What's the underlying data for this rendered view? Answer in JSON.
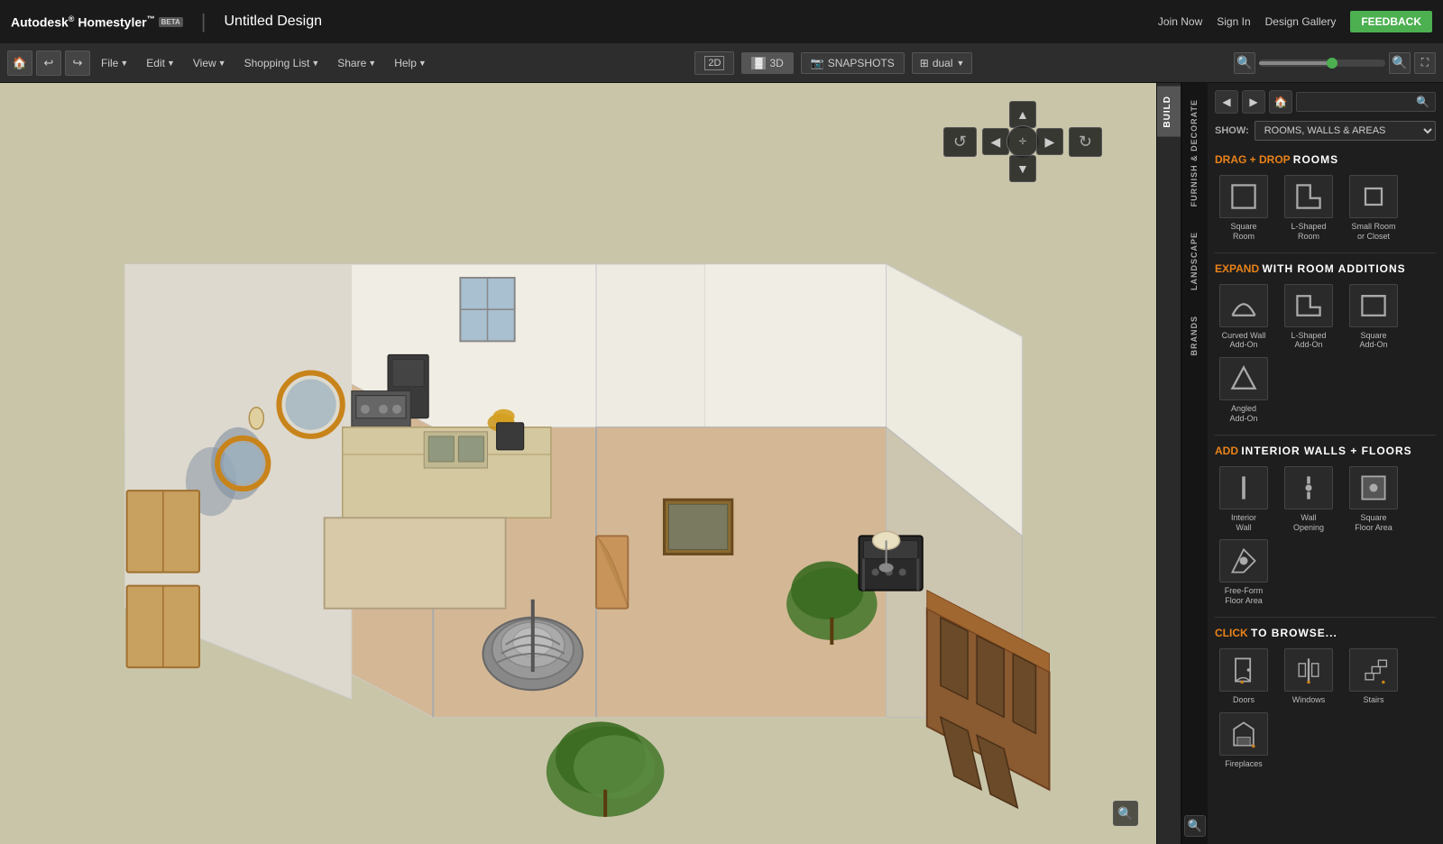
{
  "app": {
    "name": "Autodesk® Homestyler™",
    "beta_label": "BETA",
    "design_title": "Untitled Design",
    "top_bar": {
      "join_now": "Join Now",
      "sign_in": "Sign In",
      "design_gallery": "Design Gallery",
      "feedback": "FEEDBACK"
    }
  },
  "toolbar": {
    "menus": [
      "File",
      "Edit",
      "View",
      "Shopping List",
      "Share",
      "Help"
    ],
    "view_2d": "2D",
    "view_3d": "3D",
    "snapshots": "SNAPSHOTS",
    "dual": "dual"
  },
  "right_panel": {
    "show_label": "SHOW:",
    "show_value": "ROOMS, WALLS & AREAS",
    "vertical_tabs": [
      {
        "id": "build",
        "label": "BUILD",
        "active": true
      },
      {
        "id": "furnish",
        "label": "FURNISH & DECORATE",
        "active": false
      },
      {
        "id": "landscape",
        "label": "LANDSCAPE",
        "active": false
      },
      {
        "id": "brands",
        "label": "BRANDS",
        "active": false
      }
    ],
    "sections": {
      "drag_drop_rooms": {
        "prefix": "DRAG + DROP",
        "rest": "ROOMS",
        "items": [
          {
            "id": "square-room",
            "label": "Square\nRoom"
          },
          {
            "id": "l-shaped-room",
            "label": "L-Shaped\nRoom"
          },
          {
            "id": "small-room",
            "label": "Small Room\nor Closet"
          }
        ]
      },
      "expand_with": {
        "prefix": "EXPAND",
        "rest": "WITH ROOM ADDITIONS",
        "items": [
          {
            "id": "curved-wall",
            "label": "Curved Wall\nAdd-On"
          },
          {
            "id": "l-shaped-addon",
            "label": "L-Shaped\nAdd-On"
          },
          {
            "id": "square-addon",
            "label": "Square\nAdd-On"
          },
          {
            "id": "angled-addon",
            "label": "Angled\nAdd-On"
          }
        ]
      },
      "interior_walls": {
        "prefix": "ADD",
        "rest": "INTERIOR WALLS + FLOORS",
        "items": [
          {
            "id": "interior-wall",
            "label": "Interior\nWall"
          },
          {
            "id": "wall-opening",
            "label": "Wall\nOpening"
          },
          {
            "id": "square-floor",
            "label": "Square\nFloor Area"
          },
          {
            "id": "freeform-floor",
            "label": "Free-Form\nFloor Area"
          }
        ]
      },
      "click_browse": {
        "prefix": "CLICK",
        "rest": "TO BROWSE...",
        "items": [
          {
            "id": "doors",
            "label": "Doors"
          },
          {
            "id": "windows",
            "label": "Windows"
          },
          {
            "id": "stairs",
            "label": "Stairs"
          },
          {
            "id": "fireplaces",
            "label": "Fireplaces"
          }
        ]
      }
    }
  }
}
